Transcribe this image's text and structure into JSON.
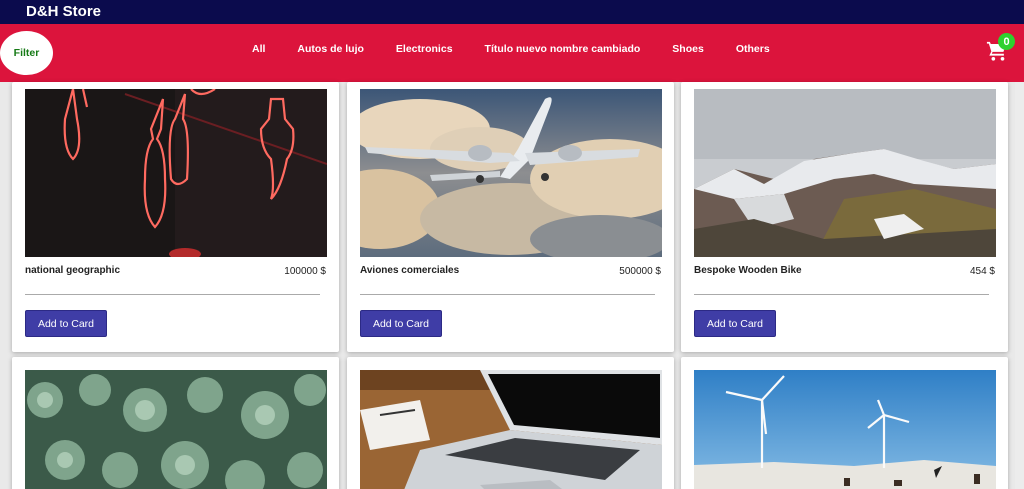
{
  "header": {
    "brand": "D&H Store"
  },
  "nav": {
    "filter_label": "Filter",
    "items": [
      "All",
      "Autos de lujo",
      "Electronics",
      "Título nuevo nombre cambiado",
      "Shoes",
      "Others"
    ],
    "cart_count": "0"
  },
  "icons": {
    "cart": "shopping-cart-icon"
  },
  "colors": {
    "topbar": "#0b0b4d",
    "navbar": "#dc143c",
    "button": "#3f3da6",
    "badge": "#2ed12e",
    "filter_text": "#167a16"
  },
  "products": [
    {
      "name": "national geographic",
      "price": "100000 $",
      "button": "Add to Card"
    },
    {
      "name": "Aviones comerciales",
      "price": "500000 $",
      "button": "Add to Card"
    },
    {
      "name": "Bespoke Wooden Bike",
      "price": "454 $",
      "button": "Add to Card"
    },
    {
      "name": "",
      "price": "",
      "button": ""
    },
    {
      "name": "",
      "price": "",
      "button": ""
    },
    {
      "name": "",
      "price": "",
      "button": ""
    }
  ]
}
